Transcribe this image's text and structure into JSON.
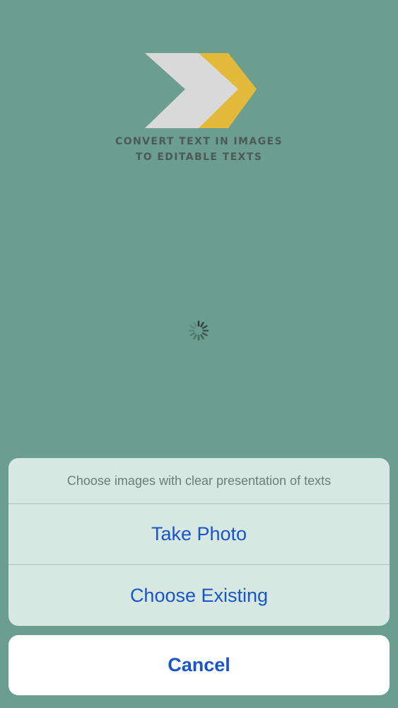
{
  "app": {
    "logo_icon": "double-chevron-logo",
    "tagline_line1": "CONVERT TEXT IN IMAGES",
    "tagline_line2": "TO EDITABLE TEXTS",
    "loading_icon": "activity-spinner-icon"
  },
  "action_sheet": {
    "message": "Choose images with clear presentation of texts",
    "actions": [
      {
        "label": "Take Photo"
      },
      {
        "label": "Choose Existing"
      }
    ],
    "cancel_label": "Cancel"
  },
  "colors": {
    "background": "#6b9e8e",
    "logo_gray": "#d9d9d9",
    "logo_yellow": "#e2b93b",
    "sheet_background": "#d6e8e1",
    "action_text": "#1a55c8"
  }
}
